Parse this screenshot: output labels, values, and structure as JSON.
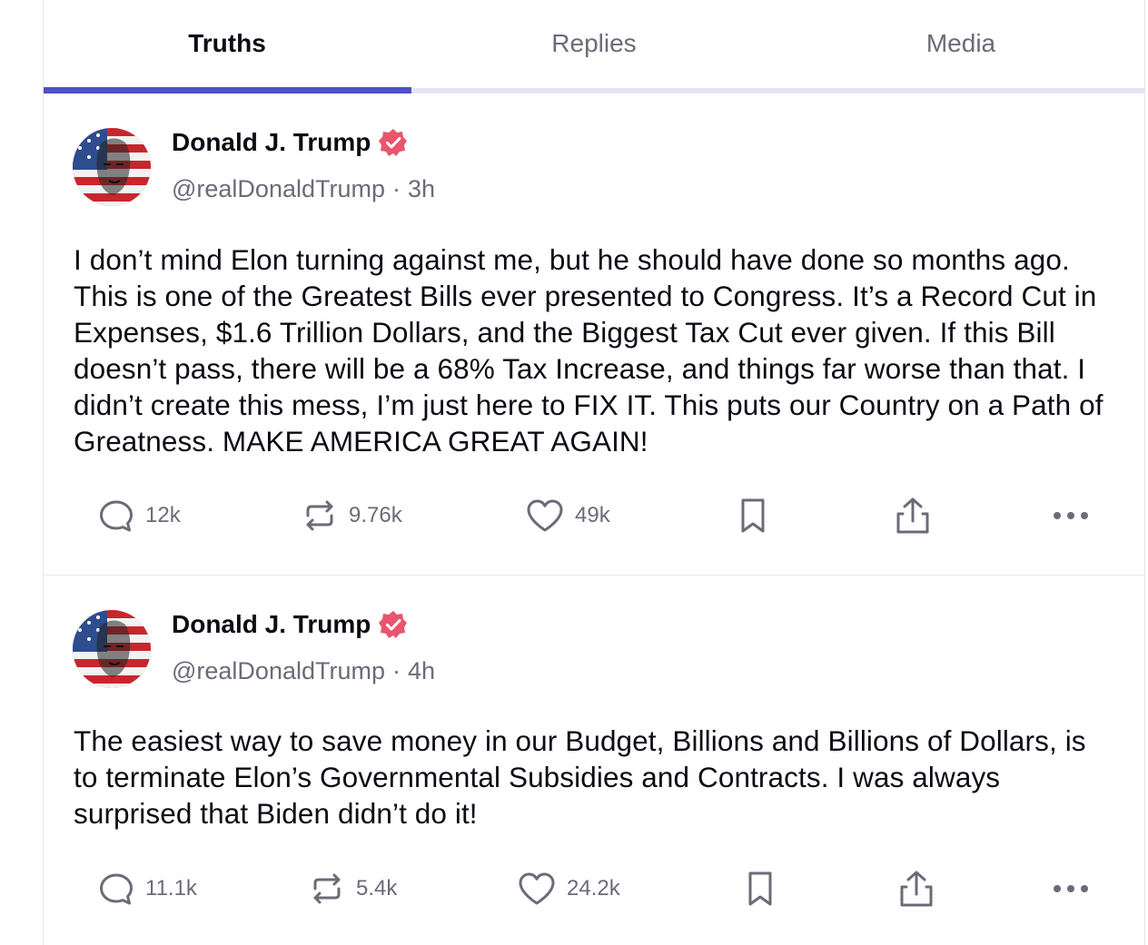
{
  "tabs": [
    {
      "label": "Truths",
      "active": true
    },
    {
      "label": "Replies",
      "active": false
    },
    {
      "label": "Media",
      "active": false
    }
  ],
  "colors": {
    "accent": "#4f4fc9",
    "verified": "#e8556d",
    "muted_text": "#6b6b78"
  },
  "posts": [
    {
      "author": "Donald J. Trump",
      "handle": "@realDonaldTrump",
      "separator": "·",
      "time": "3h",
      "text": "I don’t mind Elon turning against me, but he should have done so months ago. This is one of the Greatest Bills ever presented to Congress. It’s a Record Cut in Expenses, $1.6 Trillion Dollars, and the Biggest Tax Cut ever given. If this Bill doesn’t pass, there will be a 68% Tax Increase, and things far worse than that. I didn’t create this mess, I’m just here to FIX IT. This puts our Country on a Path of Greatness. MAKE AMERICA GREAT AGAIN!",
      "replies": "12k",
      "retruths": "9.76k",
      "likes": "49k",
      "icons": [
        "reply-icon",
        "retruth-icon",
        "like-icon",
        "bookmark-icon",
        "share-icon",
        "more-icon"
      ]
    },
    {
      "author": "Donald J. Trump",
      "handle": "@realDonaldTrump",
      "separator": "·",
      "time": "4h",
      "text": "The easiest way to save money in our Budget, Billions and Billions of Dollars, is to terminate Elon’s Governmental Subsidies and Contracts. I was always surprised that Biden didn’t do it!",
      "replies": "11.1k",
      "retruths": "5.4k",
      "likes": "24.2k",
      "icons": [
        "reply-icon",
        "retruth-icon",
        "like-icon",
        "bookmark-icon",
        "share-icon",
        "more-icon"
      ]
    }
  ]
}
